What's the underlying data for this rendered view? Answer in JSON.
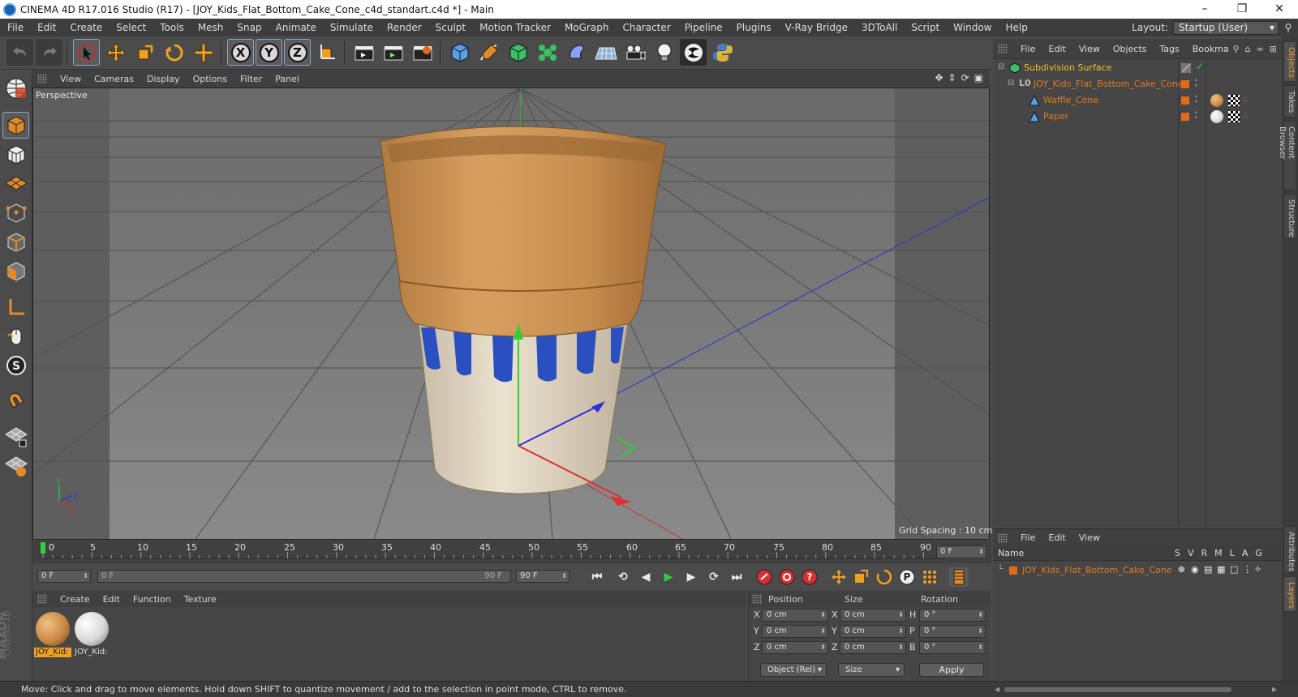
{
  "window": {
    "title": "CINEMA 4D R17.016 Studio (R17) - [JOY_Kids_Flat_Bottom_Cake_Cone_c4d_standart.c4d *] - Main"
  },
  "menubar": {
    "items": [
      "File",
      "Edit",
      "Create",
      "Select",
      "Tools",
      "Mesh",
      "Snap",
      "Animate",
      "Simulate",
      "Render",
      "Sculpt",
      "Motion Tracker",
      "MoGraph",
      "Character",
      "Pipeline",
      "Plugins",
      "V-Ray Bridge",
      "3DToAll",
      "Script",
      "Window",
      "Help"
    ],
    "layout_label": "Layout:",
    "layout_value": "Startup (User)"
  },
  "toolbar": {
    "axis_x": "X",
    "axis_y": "Y",
    "axis_z": "Z"
  },
  "viewport": {
    "menu": [
      "View",
      "Cameras",
      "Display",
      "Options",
      "Filter",
      "Panel"
    ],
    "label": "Perspective",
    "grid_spacing": "Grid Spacing : 10 cm"
  },
  "timeline": {
    "ticks": [
      "0",
      "5",
      "10",
      "15",
      "20",
      "25",
      "30",
      "35",
      "40",
      "45",
      "50",
      "55",
      "60",
      "65",
      "70",
      "75",
      "80",
      "85",
      "90"
    ],
    "current_frame": "0 F",
    "start_field": "0 F",
    "range_start": "0 F",
    "range_end": "90 F",
    "end_field": "90 F"
  },
  "materials": {
    "menu": [
      "Create",
      "Edit",
      "Function",
      "Texture"
    ],
    "items": [
      {
        "name": "JOY_Kid:",
        "color": "#c98a45"
      },
      {
        "name": "JOY_Kid:",
        "color": "#d8d8d8"
      }
    ]
  },
  "coordinates": {
    "headers": {
      "position": "Position",
      "size": "Size",
      "rotation": "Rotation"
    },
    "rows": [
      {
        "pos_axis": "X",
        "pos": "0 cm",
        "size_axis": "X",
        "size": "0 cm",
        "rot_axis": "H",
        "rot": "0 °"
      },
      {
        "pos_axis": "Y",
        "pos": "0 cm",
        "size_axis": "Y",
        "size": "0 cm",
        "rot_axis": "P",
        "rot": "0 °"
      },
      {
        "pos_axis": "Z",
        "pos": "0 cm",
        "size_axis": "Z",
        "size": "0 cm",
        "rot_axis": "B",
        "rot": "0 °"
      }
    ],
    "mode": "Object (Rel)",
    "size_mode": "Size",
    "apply": "Apply"
  },
  "statusbar": {
    "text": "Move: Click and drag to move elements. Hold down SHIFT to quantize movement / add to the selection in point mode, CTRL to remove."
  },
  "object_manager": {
    "menu": [
      "File",
      "Edit",
      "View",
      "Objects",
      "Tags",
      "Bookma"
    ],
    "objects": [
      {
        "name": "Subdivision Surface",
        "color": "#f0c020"
      },
      {
        "name": "JOY_Kids_Flat_Bottom_Cake_Cone",
        "color": "#e07a20"
      },
      {
        "name": "Waffle_Cone",
        "color": "#e07a20"
      },
      {
        "name": "Paper",
        "color": "#e07a20"
      }
    ]
  },
  "side_tabs": [
    "Objects",
    "Takes",
    "Content Browser",
    "Structure"
  ],
  "side_tabs_lower": [
    "Attributes",
    "Layers"
  ],
  "layer_manager": {
    "menu": [
      "File",
      "Edit",
      "View"
    ],
    "name_header": "Name",
    "cols": [
      "S",
      "V",
      "R",
      "M",
      "L",
      "A",
      "G"
    ],
    "layers": [
      {
        "name": "JOY_Kids_Flat_Bottom_Cake_Cone",
        "color": "#e07a20"
      }
    ]
  },
  "branding": {
    "line1": "MAXON",
    "line2": "CINEMA 4D"
  }
}
